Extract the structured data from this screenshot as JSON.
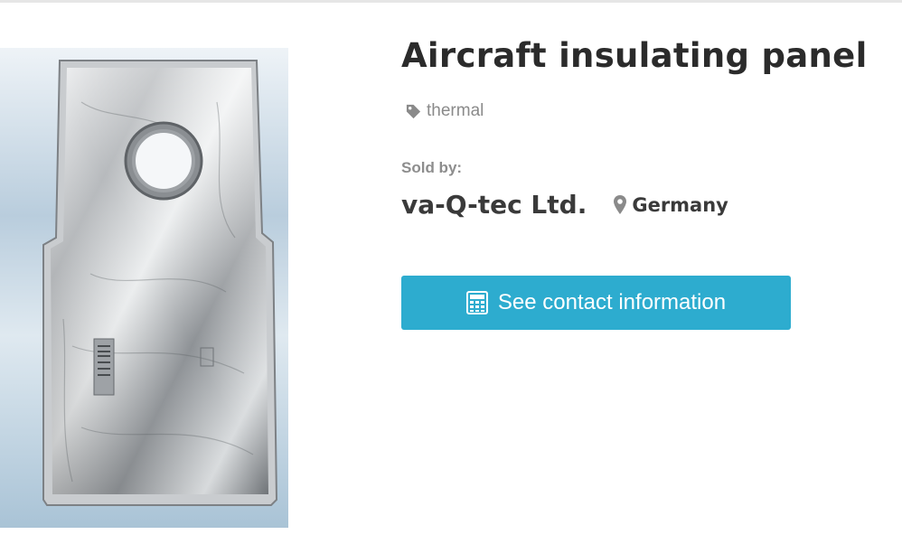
{
  "product": {
    "title": "Aircraft insulating panel",
    "tag": "thermal",
    "tag_icon": "tag-icon",
    "image_alt": "aircraft-insulating-panel-photo"
  },
  "seller": {
    "sold_by_label": "Sold by:",
    "name": "va-Q-tec Ltd.",
    "location": "Germany",
    "location_icon": "map-pin-icon"
  },
  "actions": {
    "contact_label": "See contact information",
    "contact_icon": "calculator-icon"
  },
  "colors": {
    "accent": "#2daccf",
    "title_text": "#2b2b2b",
    "muted_text": "#8a8a8a"
  }
}
